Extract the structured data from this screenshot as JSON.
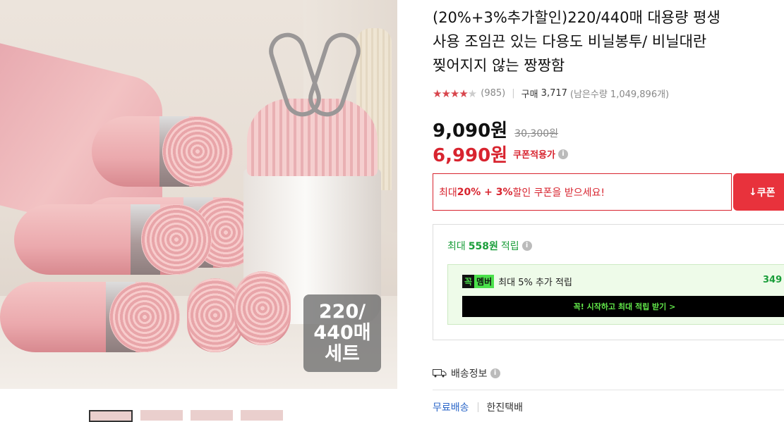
{
  "product": {
    "title_line1": "(20%+3%추가할인)220/440매 대용량 평생",
    "title_line2": "사용 조임끈 있는 다용도 비닐봉투/ 비닐대란",
    "title_line3": "찢어지지 않는 짱짱함",
    "image_badge_line1": "220/",
    "image_badge_line2": "440매",
    "image_badge_line3": "세트"
  },
  "rating": {
    "stars_filled": "★★★★",
    "stars_empty": "★",
    "review_count": "(985)",
    "purchase_label": "구매",
    "purchase_count": "3,717",
    "remaining": "(남은수량 1,049,896개)"
  },
  "price": {
    "original": "9,090원",
    "strike": "30,300원",
    "sale": "6,990원",
    "sale_label": "쿠폰적용가"
  },
  "coupon": {
    "text_prefix": "최대 ",
    "text_bold": "20% + 3%",
    "text_suffix": " 할인 쿠폰을 받으세요!",
    "button_icon": "↓",
    "button_label": "쿠폰"
  },
  "reward": {
    "prefix": "최대",
    "amount": "558원",
    "suffix": "적립",
    "member_logo_1": "꼭",
    "member_logo_2": "멤버",
    "member_text": "최대 5% 추가 적립",
    "member_amount": "349",
    "member_cta": "꼭! 시작하고 최대 적립 받기 >"
  },
  "shipping": {
    "label": "배송정보",
    "free_label": "무료배송",
    "courier": "한진택배"
  },
  "colors": {
    "sale_red": "#d8242f",
    "reward_green": "#1a9e3a",
    "link_blue": "#2a66c8"
  }
}
